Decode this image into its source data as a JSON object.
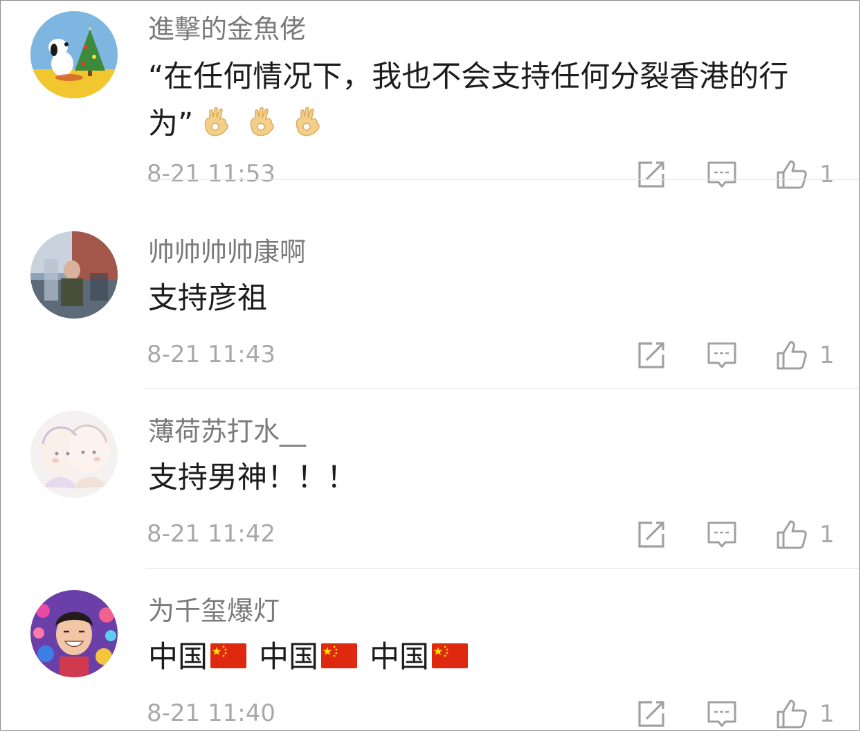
{
  "comments": [
    {
      "username": "進擊的金魚佬",
      "text": "“在任何情况下，我也不会支持任何分裂香港的行为”",
      "emoji": [
        "ok-hand",
        "ok-hand",
        "ok-hand"
      ],
      "time": "8-21 11:53",
      "likes": "1"
    },
    {
      "username": "帅帅帅帅康啊",
      "text": "支持彦祖",
      "time": "8-21 11:43",
      "likes": "1"
    },
    {
      "username": "薄荷苏打水__",
      "text": "支持男神！！！",
      "time": "8-21 11:42",
      "likes": "1"
    },
    {
      "username": "为千玺爆灯",
      "segments": [
        {
          "text": "中国",
          "emoji": "china-flag"
        },
        {
          "text": "中国",
          "emoji": "china-flag"
        },
        {
          "text": "中国",
          "emoji": "china-flag"
        }
      ],
      "time": "8-21 11:40",
      "likes": "1"
    }
  ],
  "icons": {
    "share": "share-icon",
    "reply": "reply-icon",
    "like": "thumbs-up-icon"
  },
  "colors": {
    "username": "#7a7a7a",
    "text": "#1c1c1c",
    "meta": "#a8a8a8",
    "icon": "#a0a0a0",
    "divider": "#e3e3e3"
  }
}
